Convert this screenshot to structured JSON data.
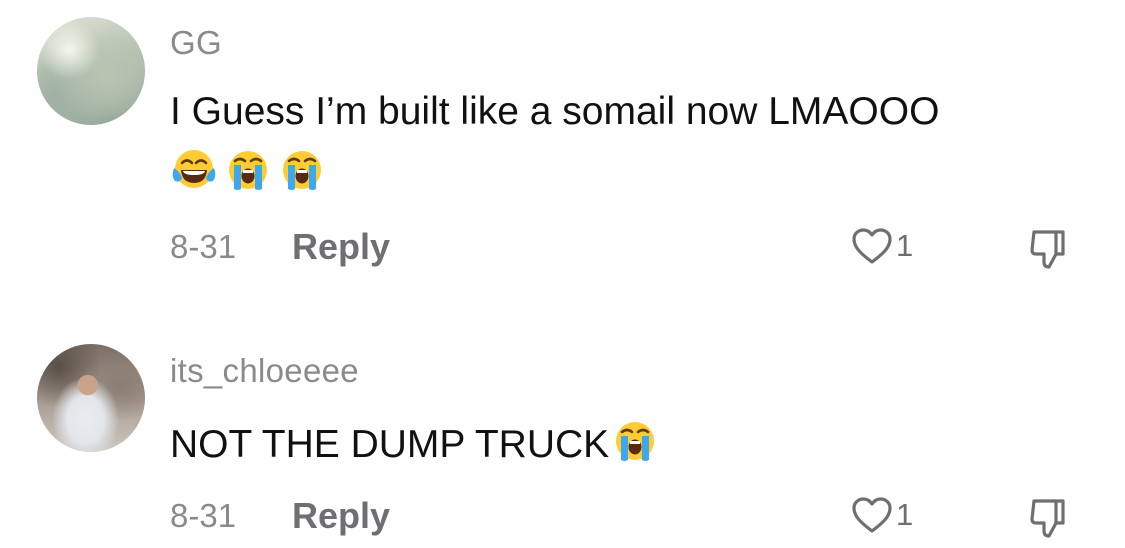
{
  "comments": [
    {
      "username": "GG",
      "text": "I Guess I’m built like a somail now LMAOOO",
      "emojis": [
        "face-with-tears-of-joy",
        "loudly-crying-face",
        "loudly-crying-face"
      ],
      "date": "8-31",
      "reply_label": "Reply",
      "like_count": "1",
      "avatar": "sky-clouds-avatar"
    },
    {
      "username": "its_chloeeee",
      "text": "NOT THE DUMP TRUCK",
      "emojis": [
        "loudly-crying-face"
      ],
      "date": "8-31",
      "reply_label": "Reply",
      "like_count": "1",
      "avatar": "person-photo-avatar"
    }
  ],
  "colors": {
    "username": "#8a8a8e",
    "text": "#111111",
    "action": "#6f6f73",
    "emoji_face": "#ffcc33",
    "tear": "#3da8f0"
  },
  "icons": {
    "like": "heart-outline-icon",
    "dislike": "thumbs-down-outline-icon"
  }
}
